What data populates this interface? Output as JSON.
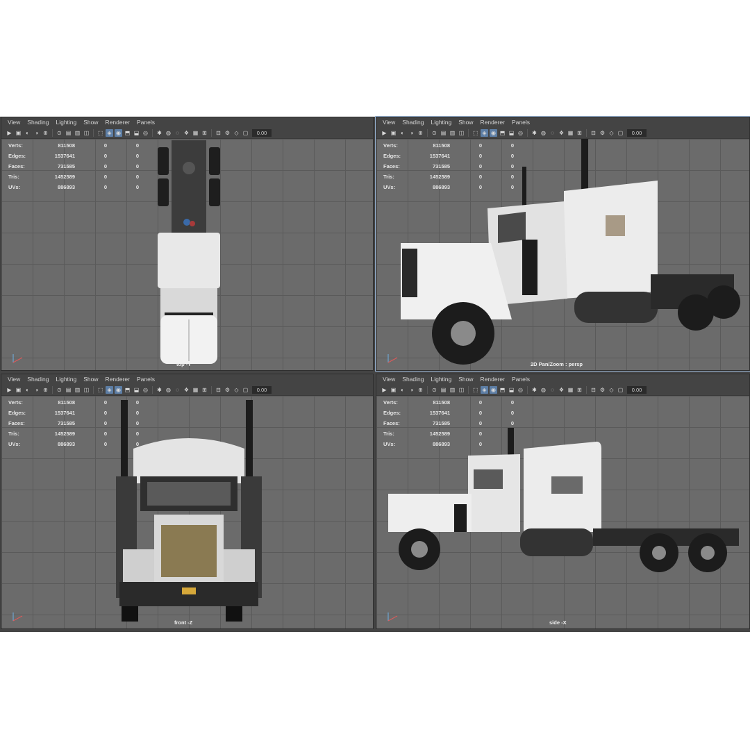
{
  "menus": [
    "View",
    "Shading",
    "Lighting",
    "Show",
    "Renderer",
    "Panels"
  ],
  "toolbar": {
    "field_value": "0.00"
  },
  "stats": [
    {
      "label": "Verts:",
      "value": "811508",
      "sel": "0",
      "comp": "0"
    },
    {
      "label": "Edges:",
      "value": "1537641",
      "sel": "0",
      "comp": "0"
    },
    {
      "label": "Faces:",
      "value": "731585",
      "sel": "0",
      "comp": "0"
    },
    {
      "label": "Tris:",
      "value": "1452589",
      "sel": "0",
      "comp": "0"
    },
    {
      "label": "UVs:",
      "value": "886893",
      "sel": "0",
      "comp": "0"
    }
  ],
  "panes": {
    "top": {
      "camera": "top -Y"
    },
    "persp": {
      "camera": "2D Pan/Zoom : persp"
    },
    "front": {
      "camera": "front -Z"
    },
    "side": {
      "camera": "side -X"
    }
  },
  "colors": {
    "accent": "#5d7ea5",
    "viewport_bg": "#6b6b6b",
    "chrome": "#444444"
  }
}
